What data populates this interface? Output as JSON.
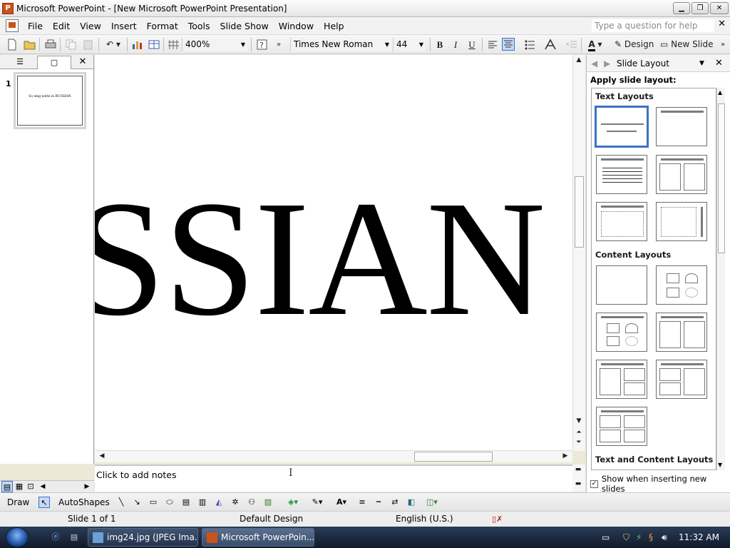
{
  "window": {
    "title": "Microsoft PowerPoint - [New Microsoft PowerPoint Presentation]",
    "minimize": "▁",
    "maximize": "❐",
    "close": "✕"
  },
  "menu": {
    "items": [
      "File",
      "Edit",
      "View",
      "Insert",
      "Format",
      "Tools",
      "Slide Show",
      "Window",
      "Help"
    ],
    "help_placeholder": "Type a question for help",
    "close": "✕"
  },
  "toolbar": {
    "zoom": "400%",
    "font_name": "Times New Roman",
    "font_size": "44",
    "bold": "B",
    "italic": "I",
    "underline": "U",
    "design_label": "Design",
    "new_slide_label": "New Slide"
  },
  "left_pane": {
    "slide_number": "1",
    "thumbnail_text": "So sing notte in RUSSIAN"
  },
  "slide": {
    "visible_text": "SSIAN"
  },
  "notes": {
    "placeholder": "Click to add notes"
  },
  "task_pane": {
    "title": "Slide Layout",
    "apply_label": "Apply slide layout:",
    "sections": [
      "Text Layouts",
      "Content Layouts",
      "Text and Content Layouts"
    ],
    "show_when_inserting": "Show when inserting new slides",
    "show_when_checked": true
  },
  "draw_toolbar": {
    "draw_label": "Draw",
    "autoshapes_label": "AutoShapes"
  },
  "status": {
    "slide_info": "Slide 1 of 1",
    "design": "Default Design",
    "language": "English (U.S.)"
  },
  "taskbar": {
    "buttons": [
      "img24.jpg (JPEG Ima...",
      "Microsoft PowerPoin..."
    ],
    "clock": "11:32 AM"
  },
  "colors": {
    "accent_blue": "#3b72c7",
    "powerpoint_orange": "#c9531a",
    "taskbar": "#1b2940"
  }
}
